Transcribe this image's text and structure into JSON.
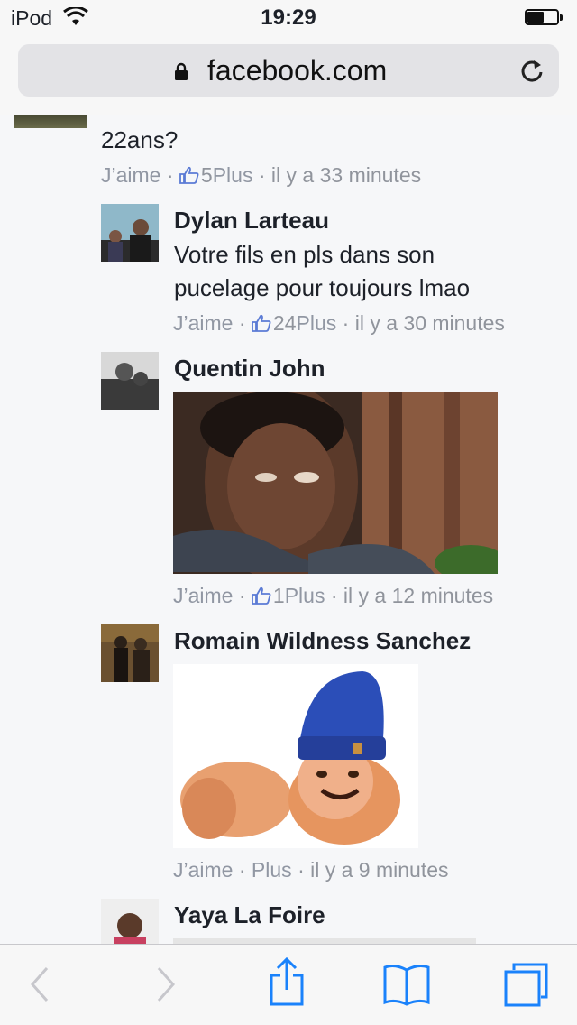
{
  "status": {
    "carrier": "iPod",
    "time": "19:29",
    "battery_level": 0.55
  },
  "address_bar": {
    "url": "facebook.com"
  },
  "thread": {
    "continued_comment": {
      "text_tail": "22ans?",
      "like_label": "J’aime",
      "like_count": "5",
      "plus": "Plus",
      "time": "il y a 33 minutes"
    },
    "replies": [
      {
        "name": "Dylan Larteau",
        "text_line1": "Votre fils en pls dans son",
        "text_line2": "pucelage pour toujours lmao",
        "like_label": "J’aime",
        "like_count": "24",
        "plus": "Plus",
        "time": "il y a 30 minutes"
      },
      {
        "name": "Quentin John",
        "image": "reaction-photo-man-sweating",
        "like_label": "J’aime",
        "like_count": "1",
        "plus": "Plus",
        "time": "il y a 12 minutes"
      },
      {
        "name": "Romain Wildness Sanchez",
        "image": "meme-man-blue-beanie",
        "like_label": "J’aime",
        "plus": "Plus",
        "time": "il y a 9 minutes"
      },
      {
        "name": "Yaya La Foire"
      }
    ]
  },
  "toolbar": {
    "back": "chevron-left-icon",
    "forward": "chevron-right-icon",
    "share": "share-icon",
    "bookmarks": "book-icon",
    "tabs": "tabs-icon",
    "accent_color": "#1a82fb"
  }
}
